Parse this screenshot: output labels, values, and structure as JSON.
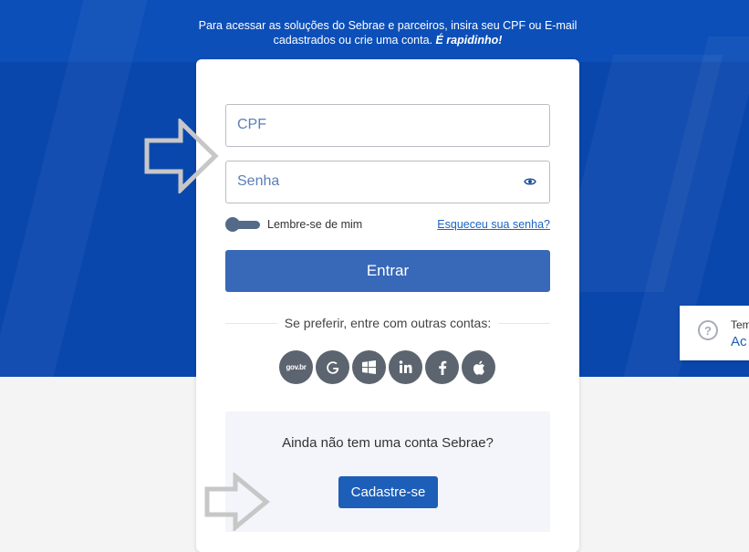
{
  "intro": {
    "line1": "Para acessar as soluções do Sebrae e parceiros, insira seu CPF ou E-mail",
    "line2": "cadastrados ou crie uma conta.",
    "emphasis": "É rapidinho!"
  },
  "login": {
    "cpf_placeholder": "CPF",
    "password_placeholder": "Senha",
    "remember_label": "Lembre-se de mim",
    "forgot_link": "Esqueceu sua senha?",
    "submit_label": "Entrar"
  },
  "social": {
    "divider_text": "Se preferir, entre com outras contas:",
    "providers": [
      {
        "name": "govbr",
        "glyph": "gov.br"
      },
      {
        "name": "google",
        "glyph": "G"
      },
      {
        "name": "microsoft",
        "glyph": ""
      },
      {
        "name": "linkedin",
        "glyph": "in"
      },
      {
        "name": "facebook",
        "glyph": "f"
      },
      {
        "name": "apple",
        "glyph": ""
      }
    ]
  },
  "signup": {
    "question": "Ainda não tem uma conta Sebrae?",
    "button_label": "Cadastre-se"
  },
  "help_widget": {
    "line1": "Tem",
    "line2": "Ac"
  },
  "colors": {
    "hero": "#0d4fb6",
    "primary_button": "#3868b8",
    "signup_button": "#1d5eb8",
    "social_icon_bg": "#5c6470",
    "link": "#1b64c2"
  }
}
